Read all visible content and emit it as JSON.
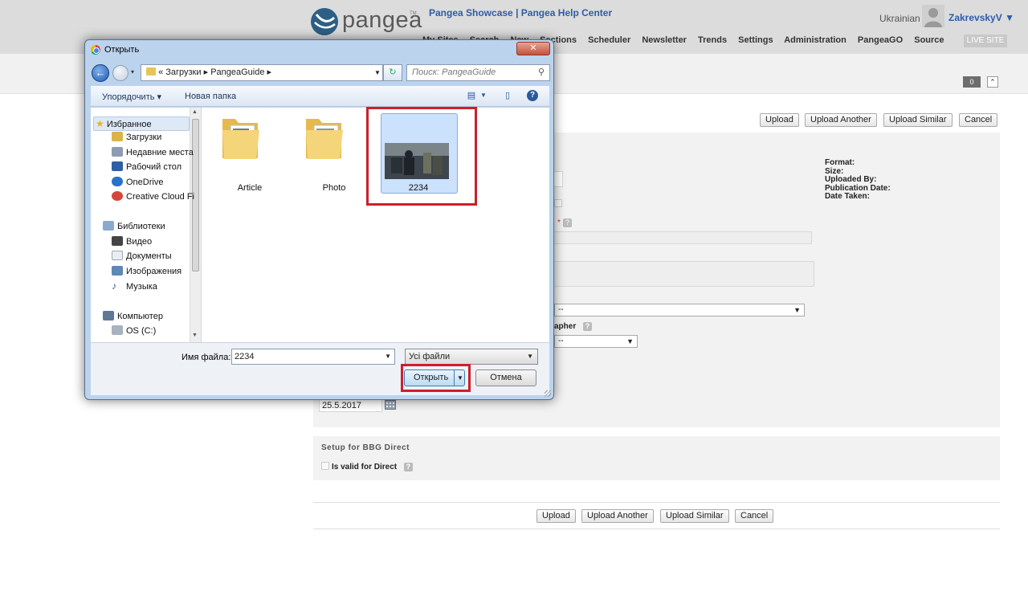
{
  "header": {
    "logo_text": "pangea",
    "logo_tm": "TM",
    "links": [
      "Pangea Showcase",
      "Pangea Help Center"
    ],
    "link_separator": "|",
    "nav": [
      "My Sites",
      "Search",
      "New",
      "Sections",
      "Scheduler",
      "Newsletter",
      "Trends",
      "Settings",
      "Administration",
      "PangeaGO",
      "Source"
    ],
    "language": "Ukrainian",
    "user": "ZakrevskyV",
    "user_caret": "▼",
    "live_site": "LIVE SITE",
    "counter": "0"
  },
  "form": {
    "top_buttons": [
      "Upload",
      "Upload Another",
      "Upload Similar",
      "Cancel"
    ],
    "bottom_buttons": [
      "Upload",
      "Upload Another",
      "Upload Similar",
      "Cancel"
    ],
    "meta_labels": [
      "Format:",
      "Size:",
      "Uploaded By:",
      "Publication Date:",
      "Date Taken:"
    ],
    "select1_value": "--",
    "select2_value": "--",
    "photographer_label": "apher",
    "date_value": "25.5.2017",
    "bbg_title": "Setup for BBG Direct",
    "direct_label": "Is valid for Direct",
    "help_glyph": "?"
  },
  "dialog": {
    "title": "Открыть",
    "close_glyph": "✕",
    "address": {
      "prefix": "«",
      "path": [
        "Загрузки",
        "PangeaGuide"
      ],
      "separator": "▸"
    },
    "search_placeholder": "Поиск: PangeaGuide",
    "toolbar": {
      "organize": "Упорядочить ▾",
      "new_folder": "Новая папка"
    },
    "nav": {
      "favorites": "Избранное",
      "favorites_items": [
        "Загрузки",
        "Недавние места",
        "Рабочий стол",
        "OneDrive",
        "Creative Cloud Fi"
      ],
      "libraries": "Библиотеки",
      "libraries_items": [
        "Видео",
        "Документы",
        "Изображения",
        "Музыка"
      ],
      "computer": "Компьютер",
      "computer_items": [
        "OS (C:)"
      ]
    },
    "files": [
      {
        "name": "Article",
        "kind": "folder"
      },
      {
        "name": "Photo",
        "kind": "folder"
      },
      {
        "name": "2234",
        "kind": "image",
        "selected": true
      }
    ],
    "filename_label": "Имя файла:",
    "filename_value": "2234",
    "filetype_value": "Усі файли",
    "open_label": "Открыть",
    "cancel_label": "Отмена",
    "colors": {
      "highlight": "#cc1f2c",
      "selection": "#cce1fb"
    }
  }
}
